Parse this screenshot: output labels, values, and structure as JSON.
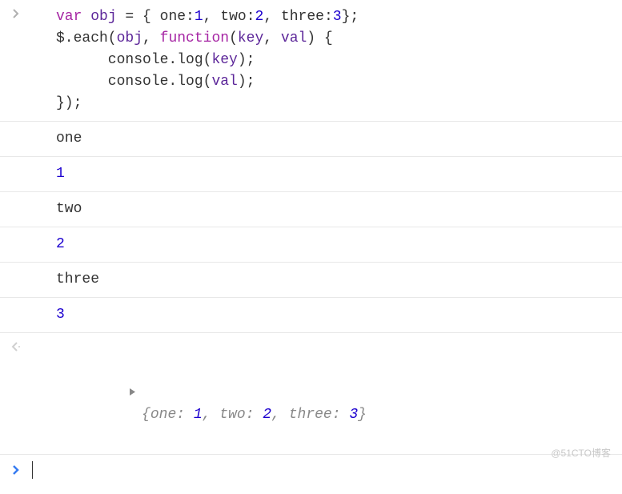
{
  "code": {
    "line1": {
      "var": "var",
      "obj": "obj",
      "eq": " = { ",
      "k1": "one",
      "c1": ":",
      "v1": "1",
      "s1": ", ",
      "k2": "two",
      "c2": ":",
      "v2": "2",
      "s2": ", ",
      "k3": "three",
      "c3": ":",
      "v3": "3",
      "end": "};"
    },
    "line2": {
      "pre": "$.each(",
      "obj": "obj",
      "mid": ", ",
      "func": "function",
      "open": "(",
      "p1": "key",
      "comma": ", ",
      "p2": "val",
      "close": ") {"
    },
    "line3": {
      "pre": "      console.log(",
      "arg": "key",
      "post": ");"
    },
    "line4": {
      "pre": "      console.log(",
      "arg": "val",
      "post": ");"
    },
    "line5": "});"
  },
  "outputs": {
    "r1": "one",
    "r2": "1",
    "r3": "two",
    "r4": "2",
    "r5": "three",
    "r6": "3"
  },
  "result": {
    "open": "{",
    "k1": "one",
    "c1": ": ",
    "v1": "1",
    "s1": ", ",
    "k2": "two",
    "c2": ": ",
    "v2": "2",
    "s2": ", ",
    "k3": "three",
    "c3": ": ",
    "v3": "3",
    "close": "}"
  },
  "watermark": "@51CTO博客"
}
